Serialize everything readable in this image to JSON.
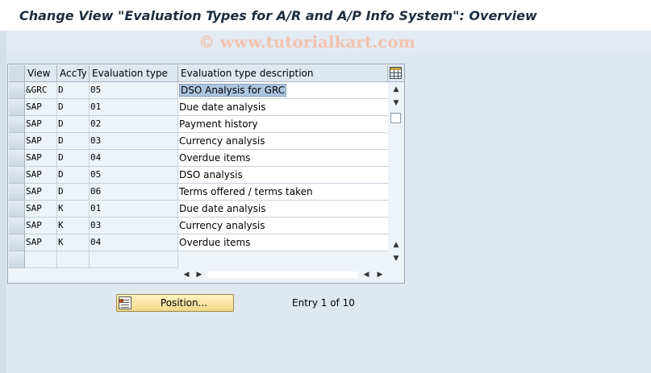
{
  "window": {
    "title": "Change View \"Evaluation Types for A/R and A/P Info System\": Overview",
    "watermark": "© www.tutorialkart.com"
  },
  "table": {
    "columns": [
      "View",
      "AccTy",
      "Evaluation type",
      "Evaluation type description"
    ],
    "rows": [
      {
        "view": "&GRC",
        "accty": "D",
        "eval_type": "05",
        "description": "DSO Analysis for GRC",
        "selected": true
      },
      {
        "view": "SAP",
        "accty": "D",
        "eval_type": "01",
        "description": "Due date analysis"
      },
      {
        "view": "SAP",
        "accty": "D",
        "eval_type": "02",
        "description": "Payment history"
      },
      {
        "view": "SAP",
        "accty": "D",
        "eval_type": "03",
        "description": "Currency analysis"
      },
      {
        "view": "SAP",
        "accty": "D",
        "eval_type": "04",
        "description": "Overdue items"
      },
      {
        "view": "SAP",
        "accty": "D",
        "eval_type": "05",
        "description": "DSO analysis"
      },
      {
        "view": "SAP",
        "accty": "D",
        "eval_type": "06",
        "description": "Terms offered / terms taken"
      },
      {
        "view": "SAP",
        "accty": "K",
        "eval_type": "01",
        "description": "Due date analysis"
      },
      {
        "view": "SAP",
        "accty": "K",
        "eval_type": "03",
        "description": "Currency analysis"
      },
      {
        "view": "SAP",
        "accty": "K",
        "eval_type": "04",
        "description": "Overdue items"
      }
    ]
  },
  "footer": {
    "position_label": "Position...",
    "entry_info": "Entry 1 of 10"
  },
  "icons": {
    "config": "table-settings-icon",
    "position": "position-icon"
  }
}
